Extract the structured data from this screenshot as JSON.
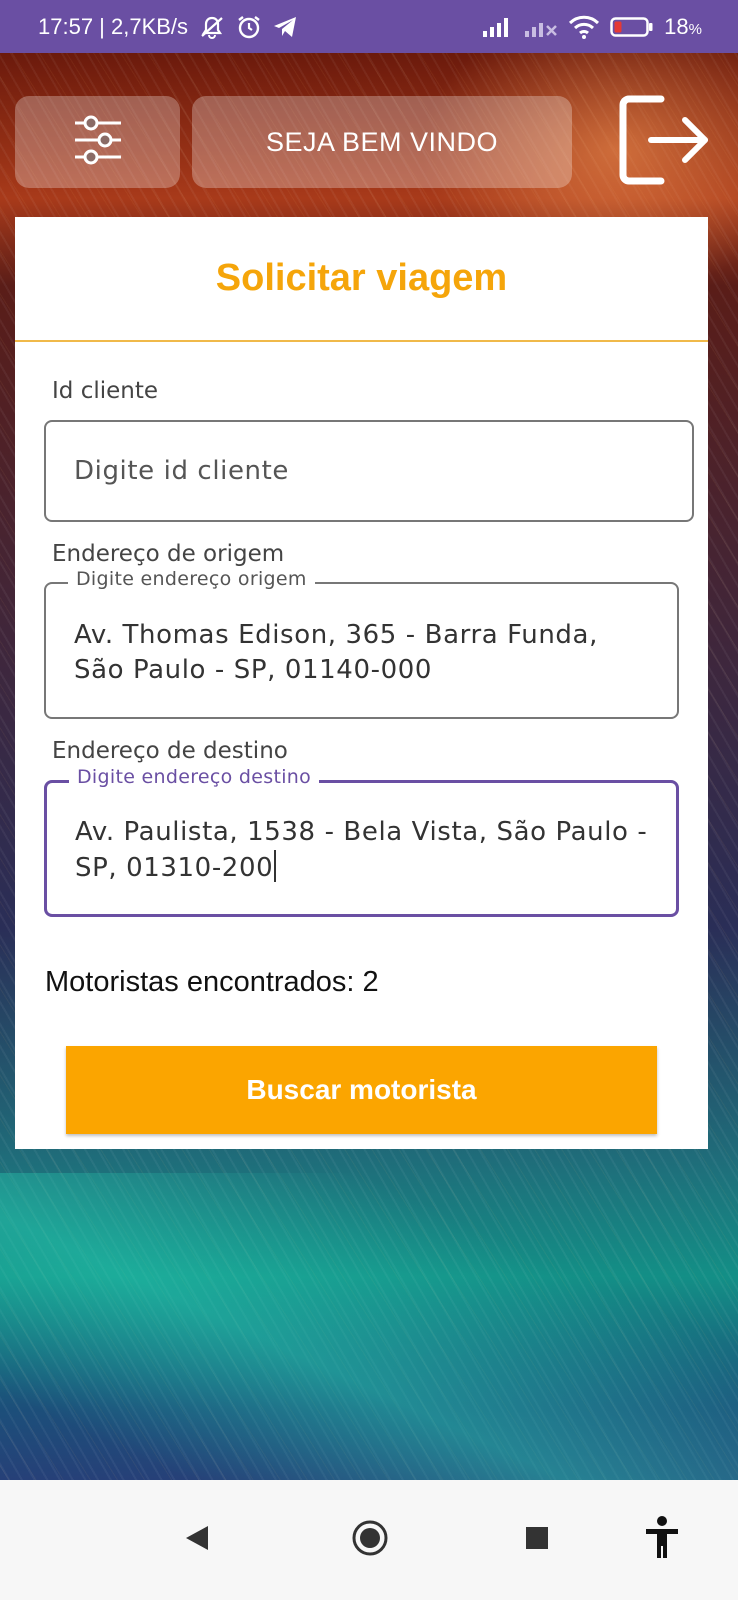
{
  "status_bar": {
    "time_speed": "17:57 | 2,7KB/s",
    "battery_pct": "18",
    "battery_unit": "%",
    "icons": [
      "mute-bell-icon",
      "alarm-icon",
      "telegram-icon",
      "signal-icon",
      "signal-nosim-icon",
      "wifi-icon",
      "battery-low-icon"
    ]
  },
  "header": {
    "welcome_label": "SEJA BEM VINDO",
    "menu_icon": "sliders-icon",
    "logout_icon": "logout-icon"
  },
  "form": {
    "title": "Solicitar viagem",
    "client": {
      "label": "Id cliente",
      "placeholder": "Digite id cliente",
      "value": ""
    },
    "origin": {
      "label": "Endereço de origem",
      "floating_label": "Digite endereço origem",
      "value": "Av. Thomas Edison, 365 - Barra Funda, São Paulo - SP, 01140-000"
    },
    "destination": {
      "label": "Endereço de destino",
      "floating_label": "Digite endereço destino",
      "value": "Av. Paulista, 1538 - Bela Vista, São Paulo - SP, 01310-200"
    },
    "drivers_found": "Motoristas encontrados: 2",
    "search_button": "Buscar motorista"
  },
  "colors": {
    "accent": "#f5a50a",
    "button": "#fba500",
    "focus": "#6a4fa3",
    "status_bar": "#6a4fa3"
  },
  "nav_bar": {
    "icons": [
      "back-icon",
      "home-icon",
      "recents-icon",
      "accessibility-icon"
    ]
  }
}
